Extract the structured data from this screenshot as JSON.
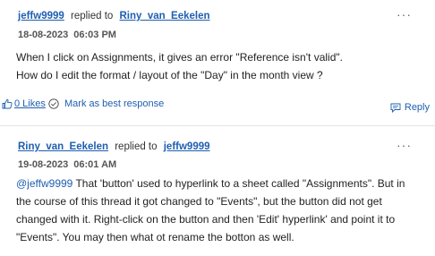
{
  "posts": [
    {
      "author": "jeffw9999",
      "replied_to_text": "replied to",
      "replied_to": "Riny_van_Eekelen",
      "date": "18-08-2023",
      "time": "06:03 PM",
      "body_line1": "When I click on Assignments, it gives an error \"Reference isn't valid\".",
      "body_line2": "How do I edit the format / layout of the \"Day\" in the month view ?",
      "likes_label": "0 Likes",
      "best_response_label": "Mark as best response",
      "reply_label": "Reply",
      "more_label": "···"
    },
    {
      "author": "Riny_van_Eekelen",
      "replied_to_text": "replied to",
      "replied_to": "jeffw9999",
      "date": "19-08-2023",
      "time": "06:01 AM",
      "mention": "@jeffw9999",
      "body_line1_rest": " That 'button' used to hyperlink to a sheet called \"Assignments\". But in",
      "body_line2": "the course of this thread it got changed to \"Events\", but the button did not get",
      "body_line3": "changed with it. Right-click on the button and then 'Edit' hyperlink' and point it to",
      "body_line4": "\"Events\". You may then what ot rename the botton as well.",
      "more_label": "···"
    }
  ],
  "colors": {
    "link": "#1e5fb0",
    "divider": "#e3e3e3"
  },
  "icons": {
    "likes": "thumbs-up-icon",
    "best": "check-circle-icon",
    "reply": "speech-bubble-icon",
    "more": "ellipsis-icon"
  }
}
